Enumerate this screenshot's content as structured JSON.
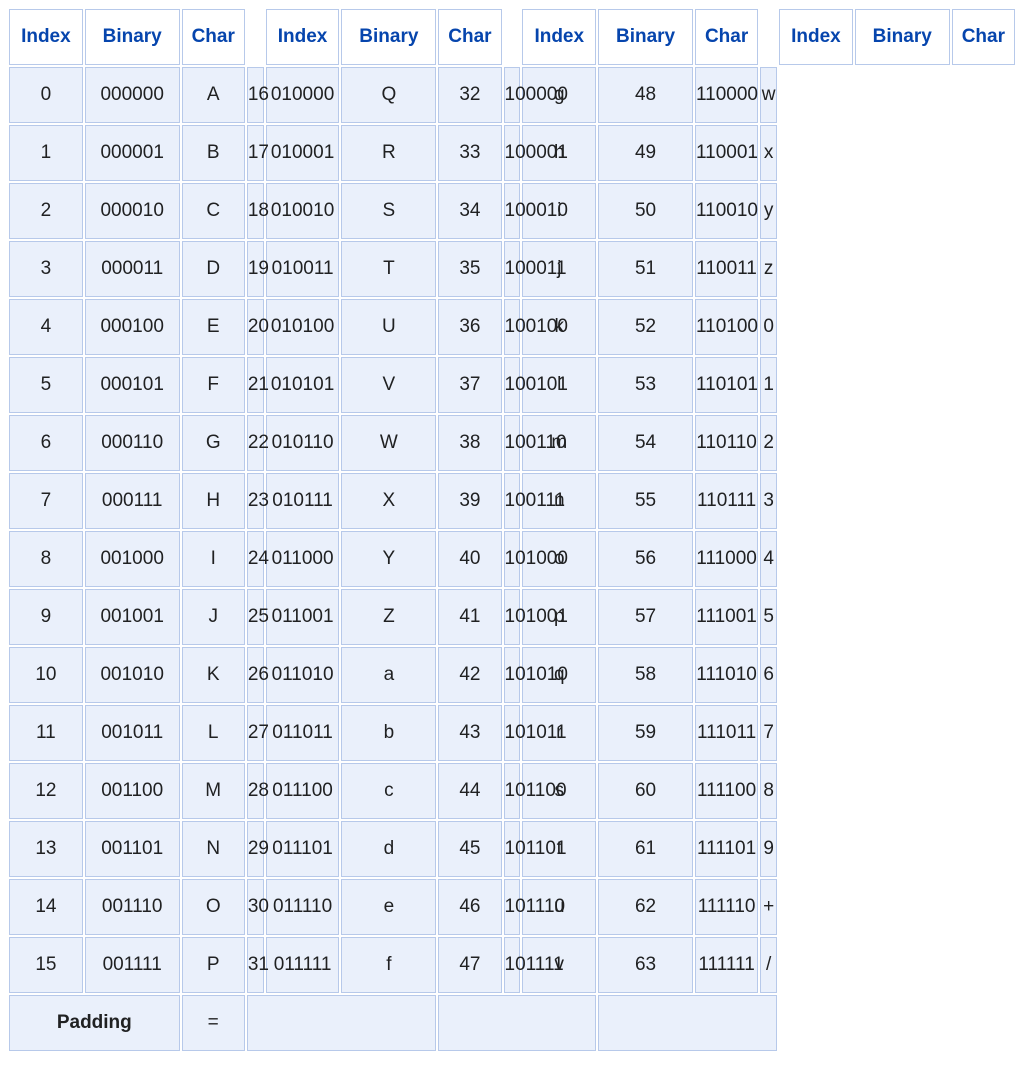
{
  "headers": {
    "index": "Index",
    "binary": "Binary",
    "char": "Char"
  },
  "padding": {
    "label": "Padding",
    "char": "="
  },
  "groups": [
    [
      {
        "index": "0",
        "binary": "000000",
        "char": "A"
      },
      {
        "index": "1",
        "binary": "000001",
        "char": "B"
      },
      {
        "index": "2",
        "binary": "000010",
        "char": "C"
      },
      {
        "index": "3",
        "binary": "000011",
        "char": "D"
      },
      {
        "index": "4",
        "binary": "000100",
        "char": "E"
      },
      {
        "index": "5",
        "binary": "000101",
        "char": "F"
      },
      {
        "index": "6",
        "binary": "000110",
        "char": "G"
      },
      {
        "index": "7",
        "binary": "000111",
        "char": "H"
      },
      {
        "index": "8",
        "binary": "001000",
        "char": "I"
      },
      {
        "index": "9",
        "binary": "001001",
        "char": "J"
      },
      {
        "index": "10",
        "binary": "001010",
        "char": "K"
      },
      {
        "index": "11",
        "binary": "001011",
        "char": "L"
      },
      {
        "index": "12",
        "binary": "001100",
        "char": "M"
      },
      {
        "index": "13",
        "binary": "001101",
        "char": "N"
      },
      {
        "index": "14",
        "binary": "001110",
        "char": "O"
      },
      {
        "index": "15",
        "binary": "001111",
        "char": "P"
      }
    ],
    [
      {
        "index": "16",
        "binary": "010000",
        "char": "Q"
      },
      {
        "index": "17",
        "binary": "010001",
        "char": "R"
      },
      {
        "index": "18",
        "binary": "010010",
        "char": "S"
      },
      {
        "index": "19",
        "binary": "010011",
        "char": "T"
      },
      {
        "index": "20",
        "binary": "010100",
        "char": "U"
      },
      {
        "index": "21",
        "binary": "010101",
        "char": "V"
      },
      {
        "index": "22",
        "binary": "010110",
        "char": "W"
      },
      {
        "index": "23",
        "binary": "010111",
        "char": "X"
      },
      {
        "index": "24",
        "binary": "011000",
        "char": "Y"
      },
      {
        "index": "25",
        "binary": "011001",
        "char": "Z"
      },
      {
        "index": "26",
        "binary": "011010",
        "char": "a"
      },
      {
        "index": "27",
        "binary": "011011",
        "char": "b"
      },
      {
        "index": "28",
        "binary": "011100",
        "char": "c"
      },
      {
        "index": "29",
        "binary": "011101",
        "char": "d"
      },
      {
        "index": "30",
        "binary": "011110",
        "char": "e"
      },
      {
        "index": "31",
        "binary": "011111",
        "char": "f"
      }
    ],
    [
      {
        "index": "32",
        "binary": "100000",
        "char": "g"
      },
      {
        "index": "33",
        "binary": "100001",
        "char": "h"
      },
      {
        "index": "34",
        "binary": "100010",
        "char": "i"
      },
      {
        "index": "35",
        "binary": "100011",
        "char": "j"
      },
      {
        "index": "36",
        "binary": "100100",
        "char": "k"
      },
      {
        "index": "37",
        "binary": "100101",
        "char": "l"
      },
      {
        "index": "38",
        "binary": "100110",
        "char": "m"
      },
      {
        "index": "39",
        "binary": "100111",
        "char": "n"
      },
      {
        "index": "40",
        "binary": "101000",
        "char": "o"
      },
      {
        "index": "41",
        "binary": "101001",
        "char": "p"
      },
      {
        "index": "42",
        "binary": "101010",
        "char": "q"
      },
      {
        "index": "43",
        "binary": "101011",
        "char": "r"
      },
      {
        "index": "44",
        "binary": "101100",
        "char": "s"
      },
      {
        "index": "45",
        "binary": "101101",
        "char": "t"
      },
      {
        "index": "46",
        "binary": "101110",
        "char": "u"
      },
      {
        "index": "47",
        "binary": "101111",
        "char": "v"
      }
    ],
    [
      {
        "index": "48",
        "binary": "110000",
        "char": "w"
      },
      {
        "index": "49",
        "binary": "110001",
        "char": "x"
      },
      {
        "index": "50",
        "binary": "110010",
        "char": "y"
      },
      {
        "index": "51",
        "binary": "110011",
        "char": "z"
      },
      {
        "index": "52",
        "binary": "110100",
        "char": "0"
      },
      {
        "index": "53",
        "binary": "110101",
        "char": "1"
      },
      {
        "index": "54",
        "binary": "110110",
        "char": "2"
      },
      {
        "index": "55",
        "binary": "110111",
        "char": "3"
      },
      {
        "index": "56",
        "binary": "111000",
        "char": "4"
      },
      {
        "index": "57",
        "binary": "111001",
        "char": "5"
      },
      {
        "index": "58",
        "binary": "111010",
        "char": "6"
      },
      {
        "index": "59",
        "binary": "111011",
        "char": "7"
      },
      {
        "index": "60",
        "binary": "111100",
        "char": "8"
      },
      {
        "index": "61",
        "binary": "111101",
        "char": "9"
      },
      {
        "index": "62",
        "binary": "111110",
        "char": "+"
      },
      {
        "index": "63",
        "binary": "111111",
        "char": "/"
      }
    ]
  ]
}
